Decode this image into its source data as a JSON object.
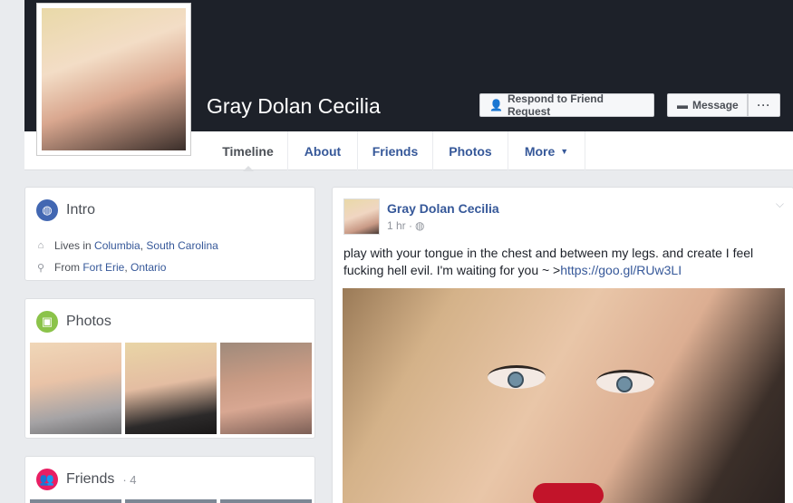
{
  "profile": {
    "name": "Gray Dolan Cecilia",
    "actions": {
      "respond_label": "Respond to Friend Request",
      "message_label": "Message",
      "more_label": "···"
    }
  },
  "tabs": [
    {
      "label": "Timeline",
      "active": true
    },
    {
      "label": "About"
    },
    {
      "label": "Friends"
    },
    {
      "label": "Photos"
    },
    {
      "label": "More"
    }
  ],
  "intro": {
    "title": "Intro",
    "lives_prefix": "Lives in",
    "lives_city": "Columbia",
    "lives_state": "South Carolina",
    "from_prefix": "From",
    "from_city": "Fort Erie",
    "from_state": "Ontario"
  },
  "photos_card": {
    "title": "Photos"
  },
  "friends_card": {
    "title": "Friends",
    "count": "· 4"
  },
  "post": {
    "author": "Gray Dolan Cecilia",
    "time": "1 hr ·",
    "text_line1": "play with your tongue in the chest and between my legs. and create I feel",
    "text_line2": "fucking hell evil. I'm waiting for you ~ >",
    "link": "https://goo.gl/RUw3LI"
  },
  "colors": {
    "cover": "#1d2129",
    "background": "#e9ebee",
    "link": "#365899",
    "intro_icon": "#4267b2",
    "photos_icon": "#8bc34a",
    "friends_icon": "#e91e63"
  },
  "icons": {
    "intro": "globe-icon",
    "photos": "image-icon",
    "friends": "people-icon",
    "respond": "person-add-icon",
    "message": "message-icon",
    "home": "house-icon",
    "location": "map-pin-icon",
    "privacy": "globe-icon"
  }
}
